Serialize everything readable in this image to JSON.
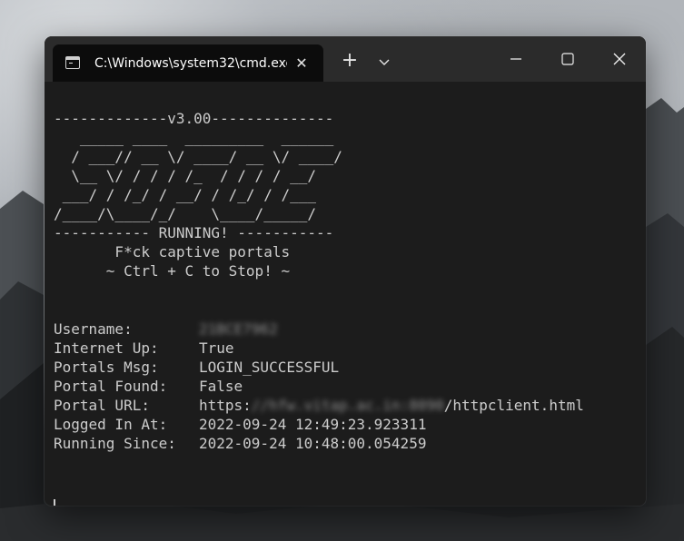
{
  "window": {
    "tab_title": "C:\\Windows\\system32\\cmd.exe"
  },
  "icons": {
    "tab": "command-prompt-icon",
    "close_tab": "close-icon",
    "new_tab": "plus-icon",
    "dropdown": "chevron-down-icon",
    "minimize": "minimize-icon",
    "maximize": "maximize-icon",
    "close_window": "close-icon"
  },
  "banner": {
    "version_line": "-------------v3.00--------------",
    "ascii_1": "   _____ ____  _________  ______",
    "ascii_2": "  / ___// __ \\/ ____/ __ \\/ ____/",
    "ascii_3": "  \\__ \\/ / / / /_  / / / / __/",
    "ascii_4": " ___/ / /_/ / __/ / /_/ / /___",
    "ascii_5": "/____/\\____/_/    \\____/_____/",
    "status_line": "----------- RUNNING! -----------",
    "tagline": "       F*ck captive portals",
    "stop_hint": "      ~ Ctrl + C to Stop! ~"
  },
  "info": {
    "username_label": "Username:",
    "username_value": "21BCE7962",
    "internet_label": "Internet Up:",
    "internet_value": "True",
    "msg_label": "Portals Msg:",
    "msg_value": "LOGIN_SUCCESSFUL",
    "found_label": "Portal Found:",
    "found_value": "False",
    "url_label": "Portal URL:",
    "url_prefix": "https:",
    "url_host": "//hfw.vitap.ac.in:8090",
    "url_path": "/httpclient.html",
    "logged_label": "Logged In At:",
    "logged_value": "2022-09-24 12:49:23.923311",
    "running_label": "Running Since:",
    "running_value": "2022-09-24 10:48:00.054259"
  },
  "colors": {
    "terminal_bg": "#1c1c1c",
    "terminal_text": "#cccccc",
    "titlebar_bg": "#2b2b2b",
    "tab_bg": "#0c0c0c"
  }
}
